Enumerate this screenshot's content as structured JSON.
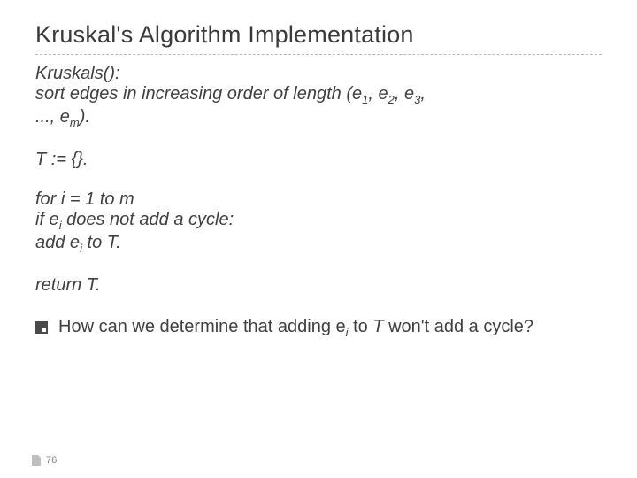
{
  "title": "Kruskal's Algorithm Implementation",
  "algo": {
    "fn": "Kruskals():",
    "sort_a": "sort edges in increasing order of length (e",
    "sort_b": ", e",
    "sort_c": ", e",
    "sort_d": ",",
    "cont_a": "..., e",
    "cont_b": ").",
    "init": "T := {}.",
    "for": "for i = 1 to m",
    "if_a": "if e",
    "if_b": " does not add a cycle:",
    "add_a": "add e",
    "add_b": " to T.",
    "ret": "return T."
  },
  "sub": {
    "s1": "1",
    "s2": "2",
    "s3": "3",
    "sm": "m",
    "si": "i"
  },
  "bullet_a": "How can we determine that adding e",
  "bullet_b": " to ",
  "bullet_c": "T",
  "bullet_d": " won't add a cycle?",
  "page": "76"
}
